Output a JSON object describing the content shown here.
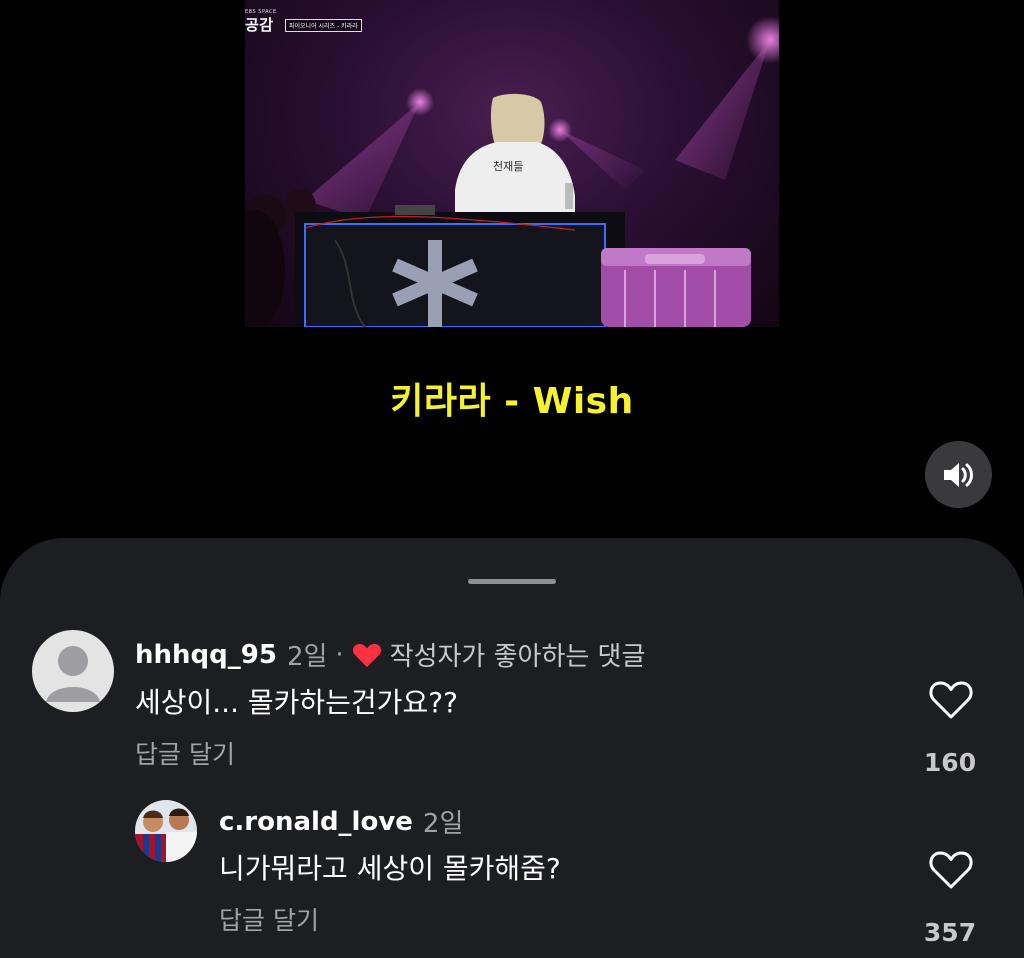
{
  "video": {
    "broadcast_logo_small": "EBS SPACE",
    "broadcast_logo_main": "공감",
    "episode_tag": "파이오니어 시리즈 - 키라라",
    "caption": "키라라  -  Wish"
  },
  "controls": {
    "mute_icon": "speaker-icon"
  },
  "comments": [
    {
      "username": "hhhqq_95",
      "time": "2일",
      "separator": "·",
      "author_liked_label": "작성자가 좋아하는 댓글",
      "text": "세상이... 몰카하는건가요??",
      "reply_label": "답글 달기",
      "like_count": "160"
    },
    {
      "username": "c.ronald_love",
      "time": "2일",
      "text": "니가뭐라고 세상이 몰카해줌?",
      "reply_label": "답글 달기",
      "like_count": "357"
    }
  ],
  "colors": {
    "caption_yellow": "#f6f32c",
    "sheet_background": "#1c1e22",
    "liked_heart": "#ff3040"
  }
}
